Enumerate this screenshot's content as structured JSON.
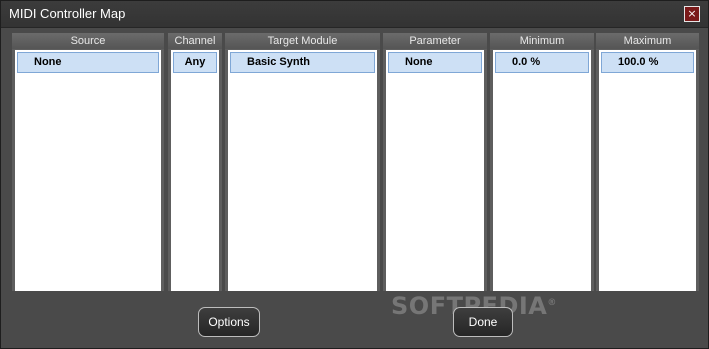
{
  "window": {
    "title": "MIDI Controller Map",
    "close_glyph": "×"
  },
  "columns": [
    {
      "header": "Source",
      "selected_value": "None"
    },
    {
      "header": "Channel",
      "selected_value": "Any"
    },
    {
      "header": "Target Module",
      "selected_value": "Basic Synth"
    },
    {
      "header": "Parameter",
      "selected_value": "None"
    },
    {
      "header": "Minimum",
      "selected_value": "0.0 %"
    },
    {
      "header": "Maximum",
      "selected_value": "100.0 %"
    }
  ],
  "buttons": {
    "options": "Options",
    "done": "Done"
  },
  "watermark": {
    "text": "SOFTPEDIA",
    "mark": "®"
  },
  "colors": {
    "selection": "#cde0f5",
    "close": "#7a1a1a"
  },
  "icons": {
    "close": "close-icon"
  }
}
